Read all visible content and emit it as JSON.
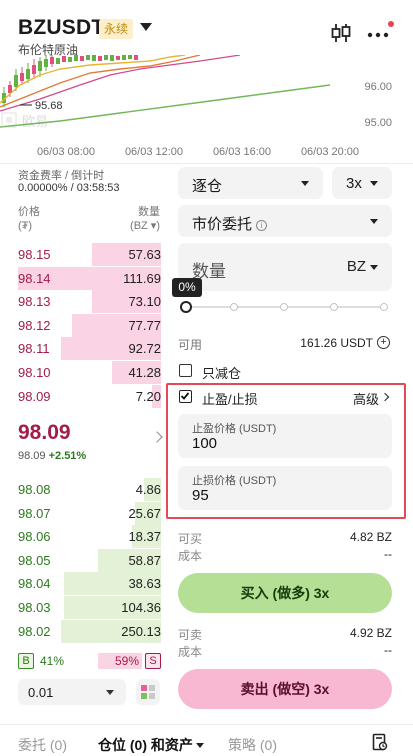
{
  "header": {
    "symbol": "BZUSDT",
    "badge": "永续",
    "subtitle": "布伦特原油"
  },
  "chart": {
    "price_labels": [
      "96.00",
      "95.00"
    ],
    "low_marker": "95.68",
    "time_labels": [
      "06/03 08:00",
      "06/03 12:00",
      "06/03 16:00",
      "06/03 20:00"
    ]
  },
  "funding": {
    "label": "资金费率 / 倒计时",
    "value": "0.00000% / 03:58:53"
  },
  "orderbook": {
    "price_header_1": "价格",
    "price_header_2": "(₮)",
    "qty_header_1": "数量",
    "qty_header_2": "(BZ ▾)",
    "asks": [
      {
        "price": "98.15",
        "qty": "57.63",
        "depth": 0.48
      },
      {
        "price": "98.14",
        "qty": "111.69",
        "depth": 1.0
      },
      {
        "price": "98.13",
        "qty": "73.10",
        "depth": 0.48
      },
      {
        "price": "98.12",
        "qty": "77.77",
        "depth": 0.62
      },
      {
        "price": "98.11",
        "qty": "92.72",
        "depth": 0.7
      },
      {
        "price": "98.10",
        "qty": "41.28",
        "depth": 0.34
      },
      {
        "price": "98.09",
        "qty": "7.20",
        "depth": 0.06
      }
    ],
    "last_price": "98.09",
    "mark_price": "98.09",
    "change": "+2.51%",
    "bids": [
      {
        "price": "98.08",
        "qty": "4.86",
        "depth": 0.12
      },
      {
        "price": "98.07",
        "qty": "25.67",
        "depth": 0.18
      },
      {
        "price": "98.06",
        "qty": "18.37",
        "depth": 0.2
      },
      {
        "price": "98.05",
        "qty": "58.87",
        "depth": 0.44
      },
      {
        "price": "98.04",
        "qty": "38.63",
        "depth": 0.68
      },
      {
        "price": "98.03",
        "qty": "104.36",
        "depth": 0.68
      },
      {
        "price": "98.02",
        "qty": "250.13",
        "depth": 0.7
      }
    ],
    "buy_ratio": "41%",
    "sell_ratio": "59%",
    "buy_badge": "B",
    "sell_badge": "S",
    "precision": "0.01"
  },
  "form": {
    "margin_mode": "逐仓",
    "leverage": "3x",
    "order_type": "市价委托",
    "qty_placeholder": "数量",
    "qty_unit": "BZ",
    "slider_pct": "0%",
    "available_label": "可用",
    "available_value": "161.26 USDT",
    "reduce_only": "只减仓",
    "tpsl_label": "止盈/止损",
    "tpsl_checked": true,
    "advanced": "高级",
    "tp_label": "止盈价格 (USDT)",
    "tp_value": "100",
    "sl_label": "止损价格 (USDT)",
    "sl_value": "95",
    "can_buy_label": "可买",
    "can_buy_value": "4.82 BZ",
    "cost_label_1": "成本",
    "cost_value_1": "--",
    "buy_button": "买入 (做多) 3x",
    "can_sell_label": "可卖",
    "can_sell_value": "4.92 BZ",
    "cost_label_2": "成本",
    "cost_value_2": "--",
    "sell_button": "卖出 (做空) 3x"
  },
  "tabs": [
    {
      "label": "委托 (0)",
      "active": false
    },
    {
      "label": "仓位 (0) 和资产",
      "active": true
    },
    {
      "label": "策略 (0)",
      "active": false
    }
  ],
  "colors": {
    "ask": "#a31c4a",
    "bid": "#2d7a1e",
    "buy_button": "#b5df95",
    "sell_button": "#f8b8d2",
    "highlight_frame": "#e24a55"
  }
}
